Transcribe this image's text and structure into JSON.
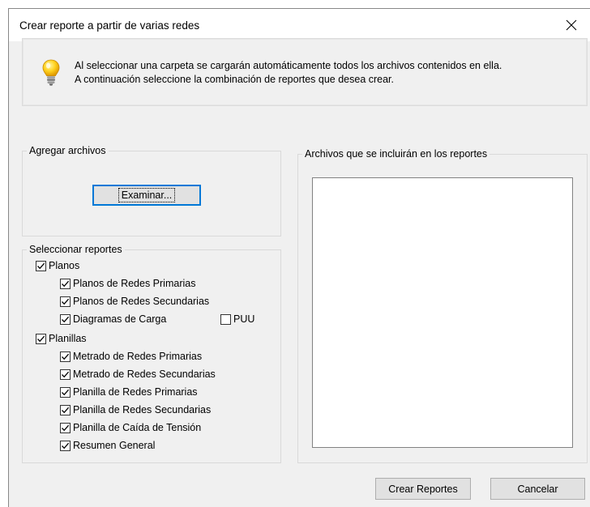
{
  "window": {
    "title": "Crear reporte a partir de varias redes",
    "close_label": "✕"
  },
  "info": {
    "icon": "lightbulb-icon",
    "line1": "Al seleccionar una carpeta se cargarán automáticamente todos los archivos contenidos en ella.",
    "line2": "A continuación seleccione la combinación de reportes que desea crear."
  },
  "add_files": {
    "legend": "Agregar archivos",
    "browse_label": "Examinar..."
  },
  "reports": {
    "legend": "Seleccionar reportes",
    "planos": {
      "label": "Planos",
      "checked": true,
      "items": [
        {
          "label": "Planos de Redes Primarias",
          "checked": true
        },
        {
          "label": "Planos de Redes Secundarias",
          "checked": true
        },
        {
          "label": "Diagramas de Carga",
          "checked": true
        }
      ],
      "puu": {
        "label": "PUU",
        "checked": false
      }
    },
    "planillas": {
      "label": "Planillas",
      "checked": true,
      "items": [
        {
          "label": "Metrado de Redes Primarias",
          "checked": true
        },
        {
          "label": "Metrado de Redes Secundarias",
          "checked": true
        },
        {
          "label": "Planilla de Redes Primarias",
          "checked": true
        },
        {
          "label": "Planilla de Redes Secundarias",
          "checked": true
        },
        {
          "label": "Planilla de Caída de Tensión",
          "checked": true
        },
        {
          "label": "Resumen General",
          "checked": true
        }
      ]
    }
  },
  "files": {
    "legend": "Archivos que se incluirán en los reportes",
    "items": []
  },
  "buttons": {
    "create": "Crear Reportes",
    "cancel": "Cancelar"
  }
}
